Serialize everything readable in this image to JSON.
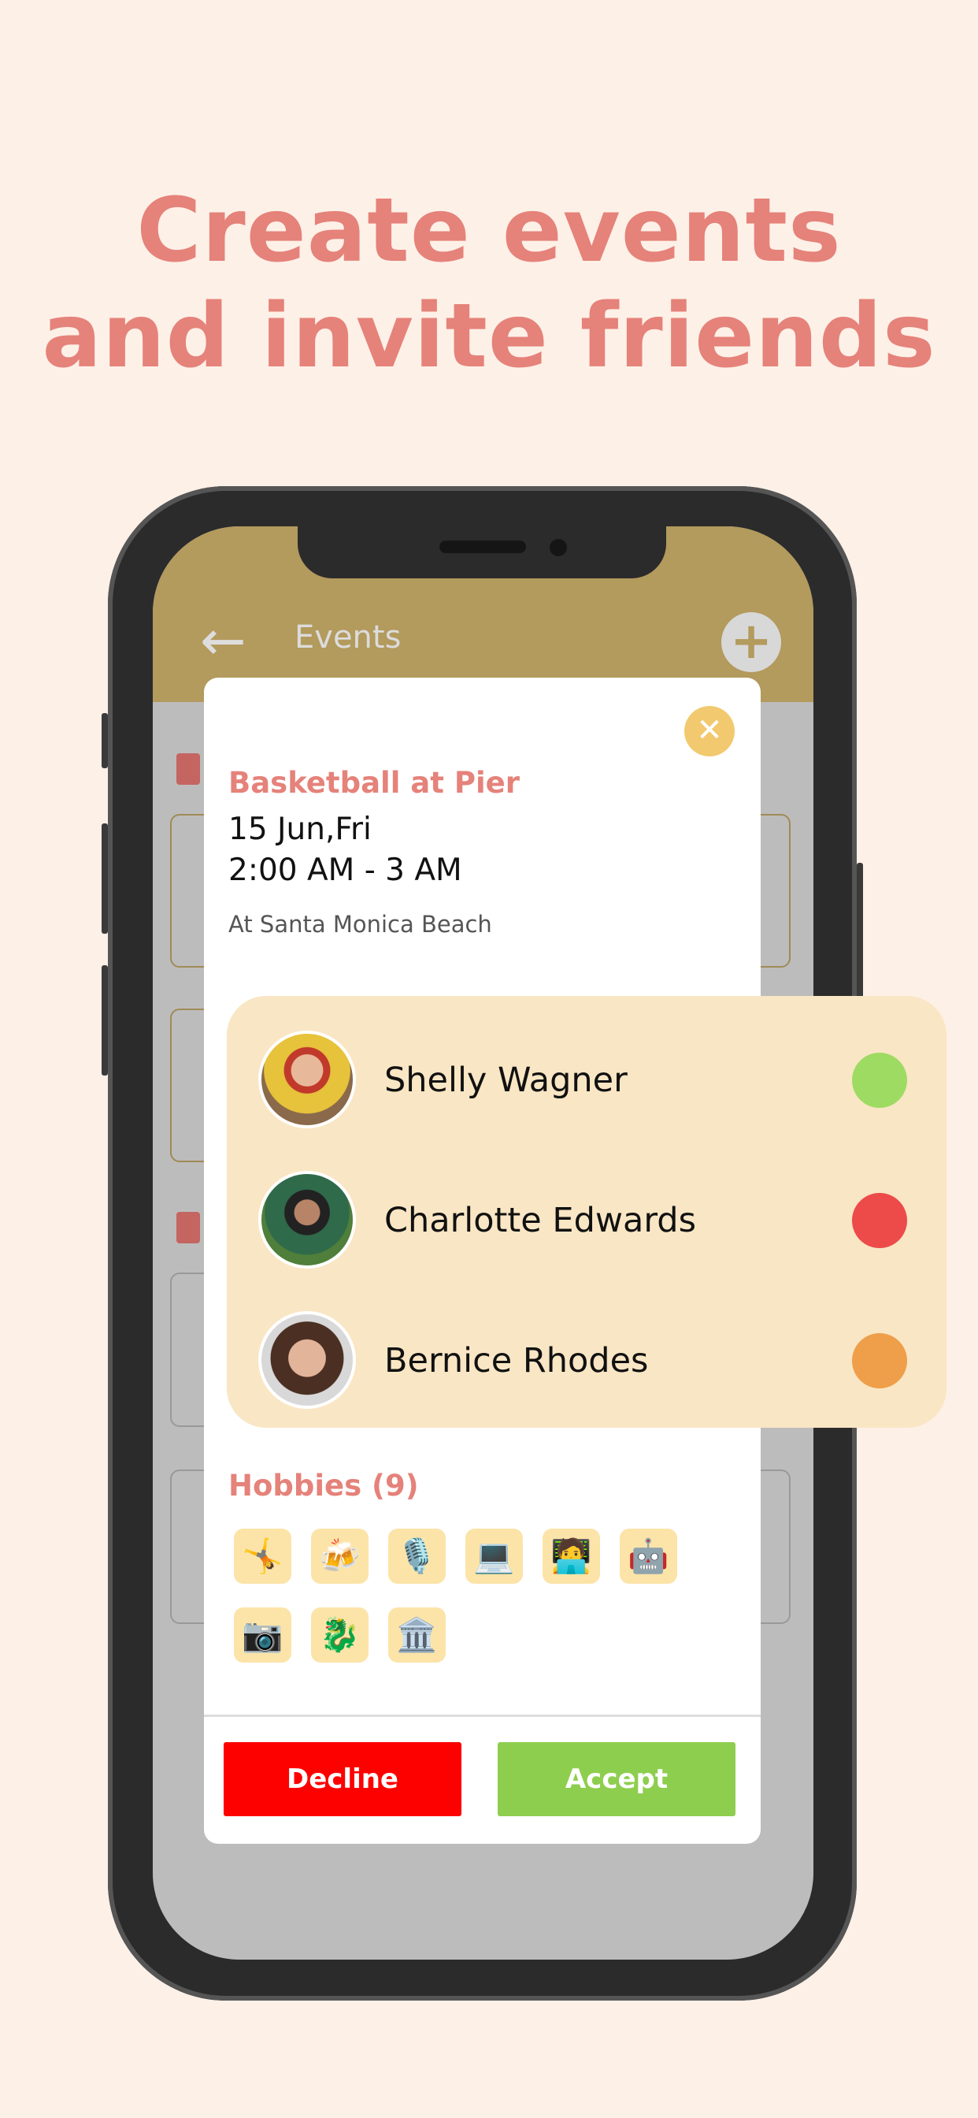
{
  "headline": {
    "line1": "Create events",
    "line2": "and invite friends"
  },
  "app": {
    "title": "Events",
    "back_icon": "arrow-left-icon",
    "add_icon": "plus-icon",
    "header_color": "#b39a5d"
  },
  "event": {
    "title": "Basketball at Pier",
    "date": "15 Jun,Fri",
    "time": "2:00 AM - 3 AM",
    "location": "At Santa Monica Beach"
  },
  "friends": [
    {
      "name": "Shelly Wagner",
      "status_color": "#9edb63"
    },
    {
      "name": "Charlotte Edwards",
      "status_color": "#ed4a4a"
    },
    {
      "name": "Bernice Rhodes",
      "status_color": "#ef9e4a"
    }
  ],
  "hobbies": {
    "title": "Hobbies (9)",
    "items": [
      "🤸",
      "🍻",
      "🎙️",
      "💻",
      "🧑‍💻",
      "🤖",
      "📷",
      "🐉",
      "🏛️"
    ]
  },
  "actions": {
    "decline": "Decline",
    "accept": "Accept"
  }
}
